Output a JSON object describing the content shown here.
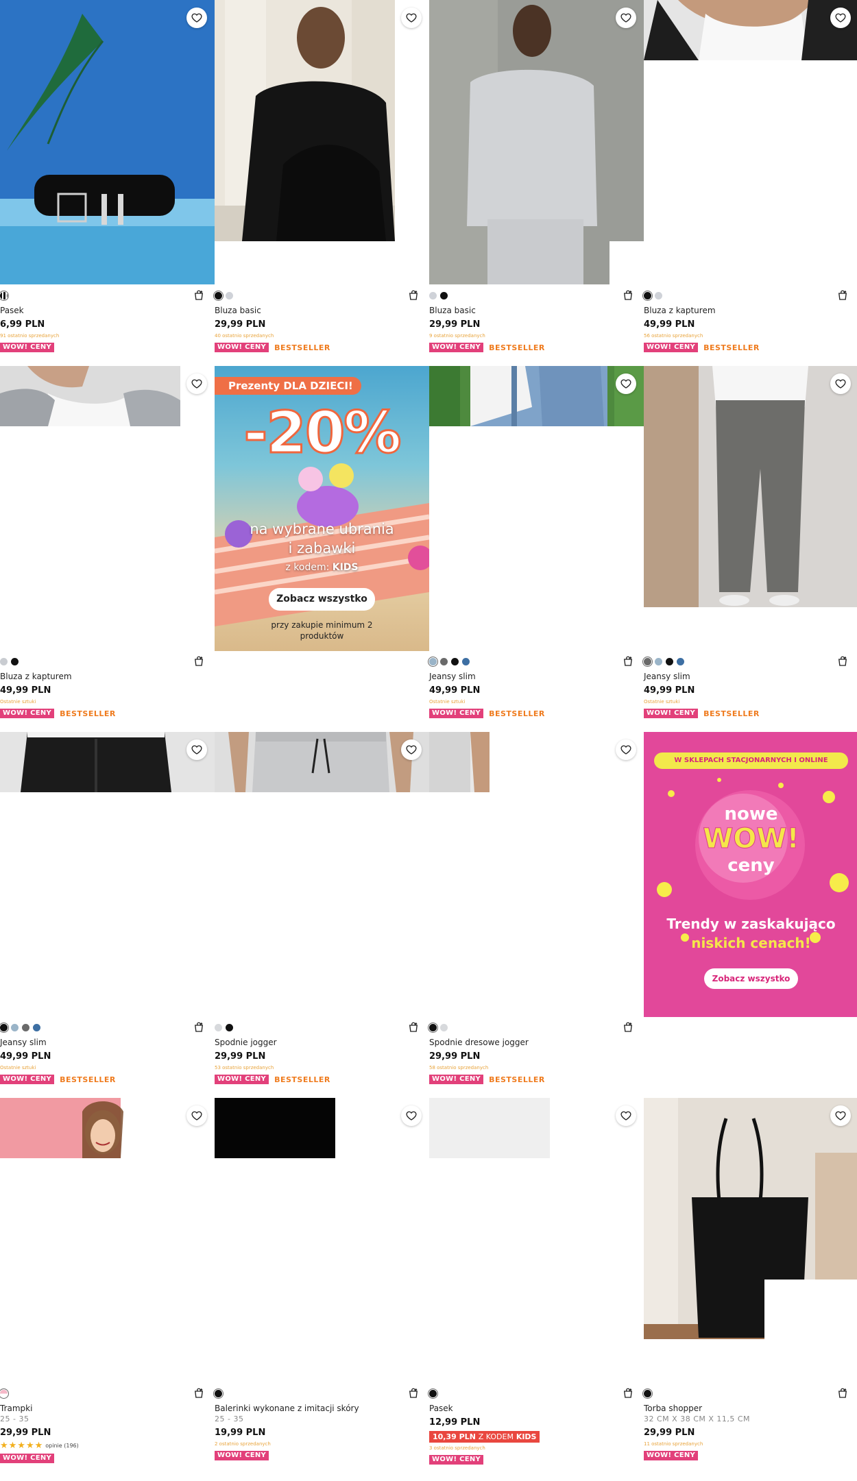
{
  "products": [
    {
      "name": "Pasek",
      "price": "6,99 PLN",
      "stock": "91 ostatnio sprzedanych",
      "badges": [
        "WOW! CENY"
      ]
    },
    {
      "name": "Bluza basic",
      "price": "29,99 PLN",
      "stock": "40 ostatnio sprzedanych",
      "badges": [
        "WOW! CENY",
        "BESTSELLER"
      ]
    },
    {
      "name": "Bluza basic",
      "price": "29,99 PLN",
      "stock": "9 ostatnio sprzedanych",
      "badges": [
        "WOW! CENY",
        "BESTSELLER"
      ]
    },
    {
      "name": "Bluza z kapturem",
      "price": "49,99 PLN",
      "stock": "56 ostatnio sprzedanych",
      "badges": [
        "WOW! CENY",
        "BESTSELLER"
      ]
    },
    {
      "name": "Bluza z kapturem",
      "price": "49,99 PLN",
      "stock": "Ostatnie sztuki",
      "badges": [
        "WOW! CENY",
        "BESTSELLER"
      ]
    },
    {
      "name": "Jeansy slim",
      "price": "49,99 PLN",
      "stock": "Ostatnie sztuki",
      "badges": [
        "WOW! CENY",
        "BESTSELLER"
      ]
    },
    {
      "name": "Jeansy slim",
      "price": "49,99 PLN",
      "stock": "Ostatnie sztuki",
      "badges": [
        "WOW! CENY",
        "BESTSELLER"
      ]
    },
    {
      "name": "Jeansy slim",
      "price": "49,99 PLN",
      "stock": "Ostatnie sztuki",
      "badges": [
        "WOW! CENY",
        "BESTSELLER"
      ]
    },
    {
      "name": "Spodnie jogger",
      "price": "29,99 PLN",
      "stock": "53 ostatnio sprzedanych",
      "badges": [
        "WOW! CENY",
        "BESTSELLER"
      ]
    },
    {
      "name": "Spodnie dresowe jogger",
      "price": "29,99 PLN",
      "stock": "58 ostatnio sprzedanych",
      "badges": [
        "WOW! CENY",
        "BESTSELLER"
      ]
    },
    {
      "name": "Trampki",
      "sub": "25 - 35",
      "price": "29,99 PLN",
      "rating_text": "opinie (196)",
      "badges": [
        "WOW! CENY"
      ]
    },
    {
      "name": "Balerinki wykonane z imitacji skóry",
      "sub": "25 - 35",
      "price": "19,99 PLN",
      "stock": "2 ostatnio sprzedanych",
      "badges": [
        "WOW! CENY"
      ]
    },
    {
      "name": "Pasek",
      "price": "12,99 PLN",
      "promo_price": "10,39 PLN",
      "promo_label": "Z KODEM",
      "promo_code": "KIDS",
      "stock": "3 ostatnio sprzedanych",
      "badges": [
        "WOW! CENY"
      ]
    },
    {
      "name": "Torba shopper",
      "sub": "32 CM X 38 CM X 11,5 CM",
      "price": "29,99 PLN",
      "stock": "11 ostatnio sprzedanych",
      "badges": [
        "WOW! CENY"
      ]
    }
  ],
  "banner_kids": {
    "tag": "Prezenty DLA DZIECI!",
    "discount": "-20%",
    "line1": "na wybrane ubrania",
    "line2": "i zabawki",
    "code_label": "z kodem:",
    "code": "KIDS",
    "cta": "Zobacz wszystko",
    "note": "przy zakupie minimum 2 produktów"
  },
  "banner_wow": {
    "tag": "W SKLEPACH STACJONARNYCH I ONLINE",
    "nowe": "nowe",
    "wow": "WOW!",
    "ceny": "ceny",
    "line1": "Trendy w zaskakująco",
    "line2": "niskich cenach!",
    "cta": "Zobacz wszystko"
  },
  "colors": {
    "accent": "#e2407a",
    "bestseller": "#ef7b1e",
    "promo": "#e9473f",
    "stock": "#e8a33a"
  }
}
